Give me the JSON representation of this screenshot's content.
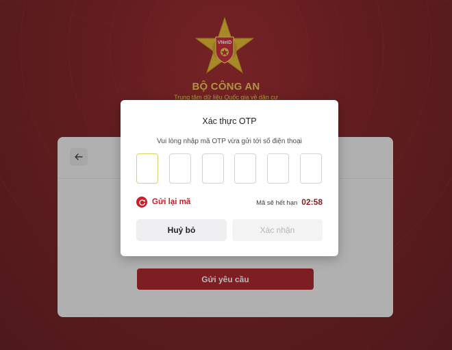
{
  "header": {
    "logo_text": "VNeID",
    "org_title": "BỘ CÔNG AN",
    "org_subtitle": "Trung tâm dữ liệu Quốc gia về dân cư"
  },
  "form": {
    "back_icon": "arrow-left-icon",
    "submit_label": "Gửi yêu cầu"
  },
  "otp_modal": {
    "title": "Xác thực OTP",
    "description": "Vui lòng nhập mã OTP vừa gửi tới số điện thoại",
    "digits": [
      "",
      "",
      "",
      "",
      "",
      ""
    ],
    "resend_icon": "refresh-icon",
    "resend_label": "Gửi lại mã",
    "expiry_label": "Mã sẽ hết hạn",
    "expiry_time": "02:58",
    "cancel_label": "Huỷ bỏ",
    "confirm_label": "Xác nhận"
  },
  "colors": {
    "brand_red": "#a8151b",
    "accent_gold": "#f2c94c",
    "timer_red": "#8e1a1e",
    "active_otp_border": "#d9d26a"
  }
}
